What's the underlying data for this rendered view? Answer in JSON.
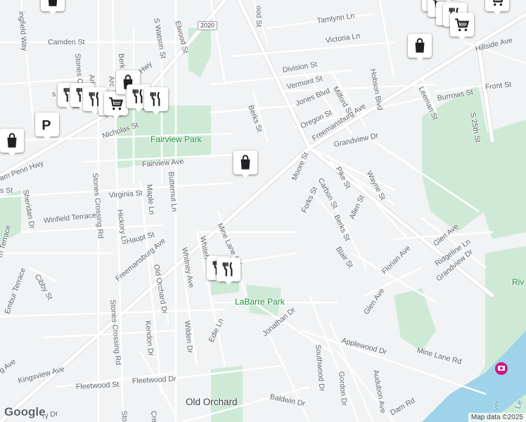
{
  "map": {
    "place_labels": {
      "old_orchard": "Old Orchard",
      "fairview_park": "Fairview Park",
      "labarre_park": "LaBarre Park",
      "riv": "Riv",
      "river": "River",
      "le": "Le"
    },
    "highway_shield": "2020",
    "streets": {
      "elwood_top": "ood St",
      "tamlynn": "Tamlynn Ln",
      "victoria": "Victoria Ln",
      "hillside": "Hillside Ave",
      "camden": "Camden St",
      "elwood": "Elwood St",
      "s_watson": "S Watson St",
      "penn_hwy_upper": "William Penn Hwy",
      "division": "Division St",
      "vermont": "Vermont St",
      "jones": "Jones Blvd",
      "milford": "Milford St",
      "hobson": "Hobson Blvd",
      "front": "Front St",
      "leeman": "Leeman St",
      "burrows": "Burrows St",
      "freemansburg_upper": "Freemansburg Ave",
      "oregon": "Oregon St",
      "s25th": "S 25th St",
      "berks_top": "Berks St",
      "nicholas": "Nicholas St",
      "penn_hwy_left": "am Penn Hwy",
      "fairview_ave": "Fairview Ave",
      "grandview_dr": "Grandview Dr",
      "moore": "Moore St",
      "carbon": "Carbon St",
      "pike": "Pike St",
      "wayne": "Wayne St",
      "forks": "Forks St",
      "allen": "Allen St",
      "berks_mid": "Berks St",
      "virginia": "Virginia St",
      "maple": "Maple Ln",
      "butternut": "Butternut Ln",
      "sheridan": "Sheridan Dr",
      "s_st": "s St",
      "stones_crossing_upper": "Stones Crossing Rd",
      "hickory": "Hickory Ln",
      "winfield": "Winfield Terrace",
      "haupt": "Haupt St",
      "mine_lane_upper": "Mine Lane Rd",
      "whitehall": "Whiteh",
      "freemansburg_lower": "Freemansburg Ave",
      "whitney": "Whitney Ave",
      "old_orchard_dr": "Old Orchard Dr",
      "blair": "Blair St",
      "florian": "Florian Ave",
      "glen_ave_upper": "Glen Ave",
      "ridgeline": "Ridgeline Ln",
      "grandview_right": "Grandview Dr",
      "glen_ave_lower": "Glen Ave",
      "terrace_left": "rn Terrace",
      "cibby": "Cibby St",
      "embur": "Embur Terrace",
      "kendon": "Kendon Dr",
      "wilden": "Wilden Dr",
      "jonathan": "Jonathan Dr",
      "southwood": "Southwood Dr",
      "applewood": "Applewood Dr",
      "mine_lane_lower": "Mine Lane Rd",
      "edie": "Edie Ln",
      "stones_crossing_lower": "Stones Crossing Rd",
      "gordon": "Gordon Dr",
      "audubon": "Audubon Ave",
      "kingsview": "Kingsview Ave",
      "g_ave": "g Ave",
      "fleetwood_left": "Fleetwood St",
      "fleetwood_right": "Fleetwood Dr",
      "baldwin": "Baldwin Dr",
      "dam_rd": "Dam Rd",
      "cresc": "Cresc",
      "ston": "Ston",
      "ry_dr": "ry Dr",
      "ingfield": "ingfield Way",
      "stones_c": "Stones C",
      "arlington": "Arlington",
      "berk_upper": "Berk",
      "arc": "Arc",
      "s_left": "s"
    },
    "pins": [
      {
        "type": "shopping",
        "icon": "shopping-bag-icon"
      },
      {
        "type": "shopping",
        "icon": "shopping-bag-icon"
      },
      {
        "type": "shopping",
        "icon": "shopping-cart-icon"
      },
      {
        "type": "shopping",
        "icon": "shopping-cart-icon"
      },
      {
        "type": "shopping",
        "icon": "shopping-bag-icon"
      },
      {
        "type": "restaurant",
        "icon": "restaurant-icon"
      },
      {
        "type": "shopping",
        "icon": "shopping-cart-icon"
      },
      {
        "type": "shopping",
        "icon": "shopping-bag-icon"
      },
      {
        "type": "restaurant",
        "icon": "restaurant-icon"
      },
      {
        "type": "restaurant",
        "icon": "restaurant-icon"
      },
      {
        "type": "restaurant",
        "icon": "restaurant-icon"
      },
      {
        "type": "restaurant",
        "icon": "restaurant-icon"
      },
      {
        "type": "shopping",
        "icon": "shopping-cart-icon"
      },
      {
        "type": "shopping",
        "icon": "shopping-bag-icon"
      },
      {
        "type": "restaurant",
        "icon": "restaurant-icon"
      },
      {
        "type": "restaurant",
        "icon": "restaurant-icon"
      },
      {
        "type": "parking",
        "icon": "parking-icon",
        "label": "P"
      },
      {
        "type": "shopping",
        "icon": "shopping-bag-icon"
      },
      {
        "type": "shopping",
        "icon": "shopping-bag-icon"
      },
      {
        "type": "restaurant",
        "icon": "restaurant-icon"
      },
      {
        "type": "restaurant",
        "icon": "restaurant-icon"
      }
    ],
    "attribution": "Map data ©2025",
    "logo_text": "Google",
    "colors": {
      "background": "#f1f3f4",
      "road": "#ffffff",
      "road_edge": "#dadce0",
      "park": "#ceead6",
      "water": "#9fd3e9",
      "pin_icon": "#202124",
      "museum": "#d01884"
    }
  }
}
